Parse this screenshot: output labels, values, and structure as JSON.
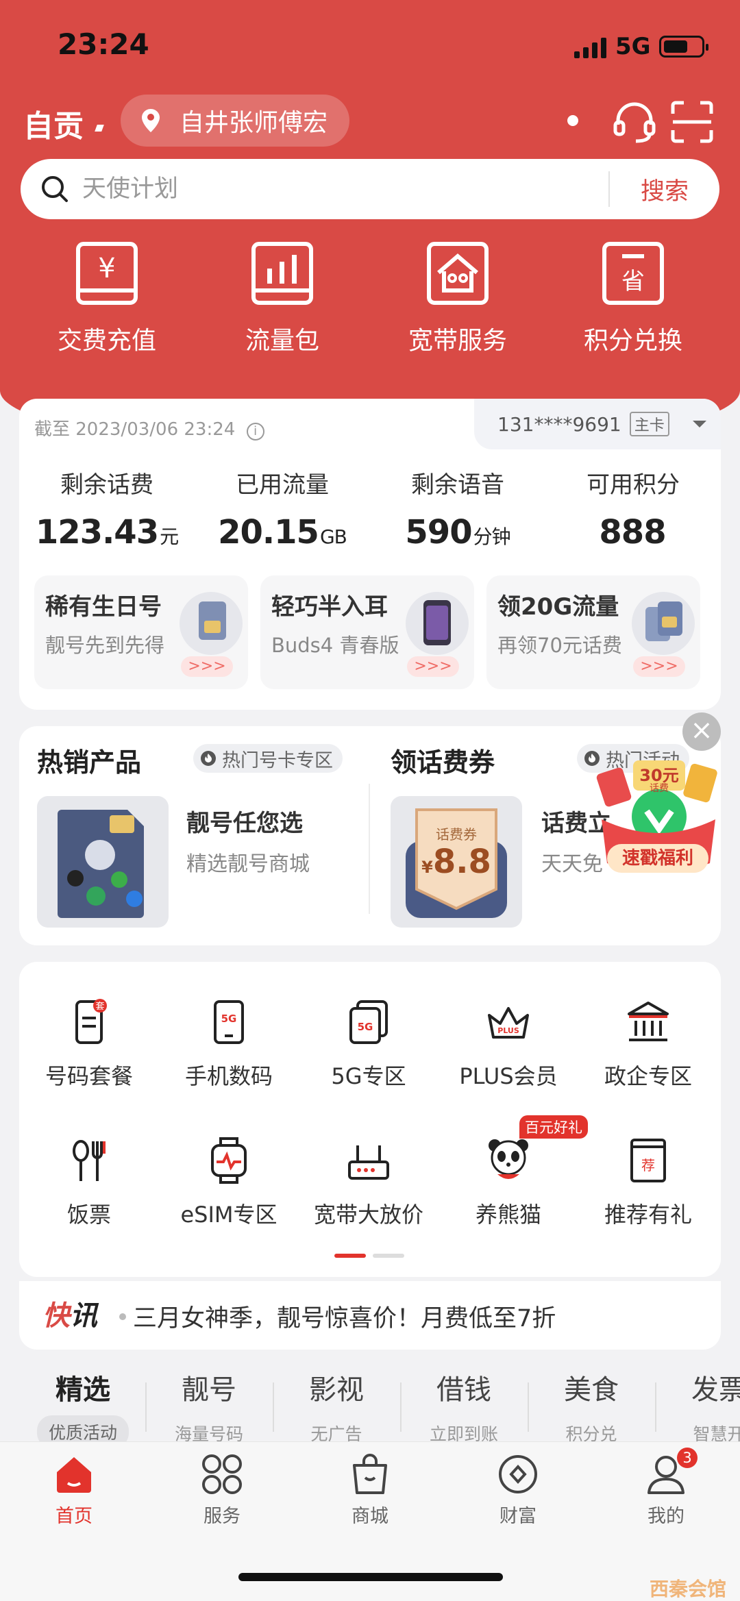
{
  "status": {
    "time": "23:24",
    "network": "5G"
  },
  "header": {
    "city": "自贡",
    "location": "自井张师傅宏",
    "colors": {
      "brand": "#d94a45",
      "accent": "#e2332c"
    }
  },
  "search": {
    "placeholder": "天使计划",
    "button": "搜索"
  },
  "quick": [
    {
      "label": "交费充值",
      "icon": "yuan-card-icon"
    },
    {
      "label": "流量包",
      "icon": "bar-chart-icon"
    },
    {
      "label": "宽带服务",
      "icon": "broadband-house-icon"
    },
    {
      "label": "积分兑换",
      "icon": "save-card-icon"
    }
  ],
  "account": {
    "as_of": "截至 2023/03/06 23:24",
    "phone": "131****9691",
    "tag": "主卡",
    "stats": [
      {
        "label": "剩余话费",
        "value": "123.43",
        "unit": "元"
      },
      {
        "label": "已用流量",
        "value": "20.15",
        "unit": "GB"
      },
      {
        "label": "剩余语音",
        "value": "590",
        "unit": "分钟"
      },
      {
        "label": "可用积分",
        "value": "888",
        "unit": ""
      }
    ],
    "promos": [
      {
        "title": "稀有生日号",
        "sub": "靓号先到先得"
      },
      {
        "title": "轻巧半入耳",
        "sub": "Buds4 青春版"
      },
      {
        "title": "领20G流量",
        "sub": "再领70元话费"
      }
    ],
    "promo_arrow": ">>>"
  },
  "hot": {
    "left": {
      "title": "热销产品",
      "chip": "热门号卡专区",
      "item_title": "靓号任您选",
      "item_sub": "精选靓号商城"
    },
    "right": {
      "title": "领话费券",
      "chip": "热门活动",
      "item_title": "话费立",
      "item_sub": "天天免",
      "coupon_label": "话费券",
      "coupon_value": "8.8",
      "coupon_currency": "¥"
    },
    "close": "×",
    "float_ad": {
      "amount": "30元",
      "sub": "话费",
      "label": "速戳福利"
    }
  },
  "grid": {
    "row1": [
      {
        "label": "号码套餐",
        "icon": "sim-phone-icon",
        "mini": "套"
      },
      {
        "label": "手机数码",
        "icon": "5g-phone-icon",
        "mini": "5G"
      },
      {
        "label": "5G专区",
        "icon": "5g-cards-icon",
        "mini": "5G"
      },
      {
        "label": "PLUS会员",
        "icon": "crown-icon",
        "mini": "PLUS"
      },
      {
        "label": "政企专区",
        "icon": "bank-icon",
        "mini": ""
      }
    ],
    "row2": [
      {
        "label": "饭票",
        "icon": "spoon-fork-icon",
        "mini": ""
      },
      {
        "label": "eSIM专区",
        "icon": "watch-icon",
        "mini": ""
      },
      {
        "label": "宽带大放价",
        "icon": "router-icon",
        "mini": ""
      },
      {
        "label": "养熊猫",
        "icon": "panda-icon",
        "mini": ""
      },
      {
        "label": "推荐有礼",
        "icon": "recommend-icon",
        "mini": "荐"
      }
    ],
    "panda_badge": "百元好礼"
  },
  "news": {
    "label_a": "快",
    "label_b": "讯",
    "text": "三月女神季，靓号惊喜价！月费低至7折"
  },
  "categories": [
    {
      "name": "精选",
      "sub": "优质活动"
    },
    {
      "name": "靓号",
      "sub": "海量号码"
    },
    {
      "name": "影视",
      "sub": "无广告"
    },
    {
      "name": "借钱",
      "sub": "立即到账"
    },
    {
      "name": "美食",
      "sub": "积分兑"
    },
    {
      "name": "发票",
      "sub": "智慧开"
    }
  ],
  "tabs": [
    {
      "label": "首页",
      "icon": "home-icon"
    },
    {
      "label": "服务",
      "icon": "grid-services-icon"
    },
    {
      "label": "商城",
      "icon": "shopping-bag-icon"
    },
    {
      "label": "财富",
      "icon": "wealth-icon"
    },
    {
      "label": "我的",
      "icon": "profile-icon",
      "badge": "3"
    }
  ],
  "watermark": "西秦会馆"
}
